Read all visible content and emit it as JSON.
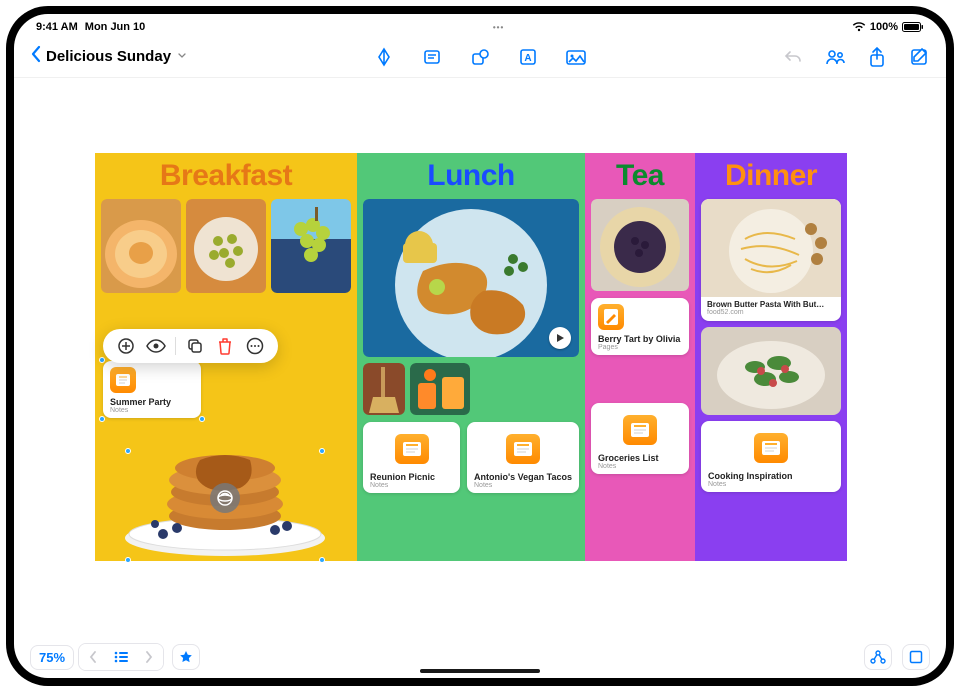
{
  "status": {
    "time": "9:41 AM",
    "date": "Mon Jun 10",
    "battery_pct": "100%"
  },
  "toolbar": {
    "board_title": "Delicious Sunday"
  },
  "columns": {
    "breakfast": {
      "title": "Breakfast"
    },
    "lunch": {
      "title": "Lunch"
    },
    "tea": {
      "title": "Tea"
    },
    "dinner": {
      "title": "Dinner"
    }
  },
  "cards": {
    "summer_party": {
      "title": "Summer Party",
      "sub": "Notes"
    },
    "reunion_picnic": {
      "title": "Reunion Picnic",
      "sub": "Notes"
    },
    "vegan_tacos": {
      "title": "Antonio's Vegan Tacos",
      "sub": "Notes"
    },
    "berry_tart": {
      "title": "Berry Tart by Olivia",
      "sub": "Pages"
    },
    "groceries": {
      "title": "Groceries List",
      "sub": "Notes"
    },
    "cooking_insp": {
      "title": "Cooking Inspiration",
      "sub": "Notes"
    },
    "pasta_link": {
      "title": "Brown Butter Pasta With But…",
      "domain": "food52.com"
    }
  },
  "bottom": {
    "zoom": "75%"
  }
}
